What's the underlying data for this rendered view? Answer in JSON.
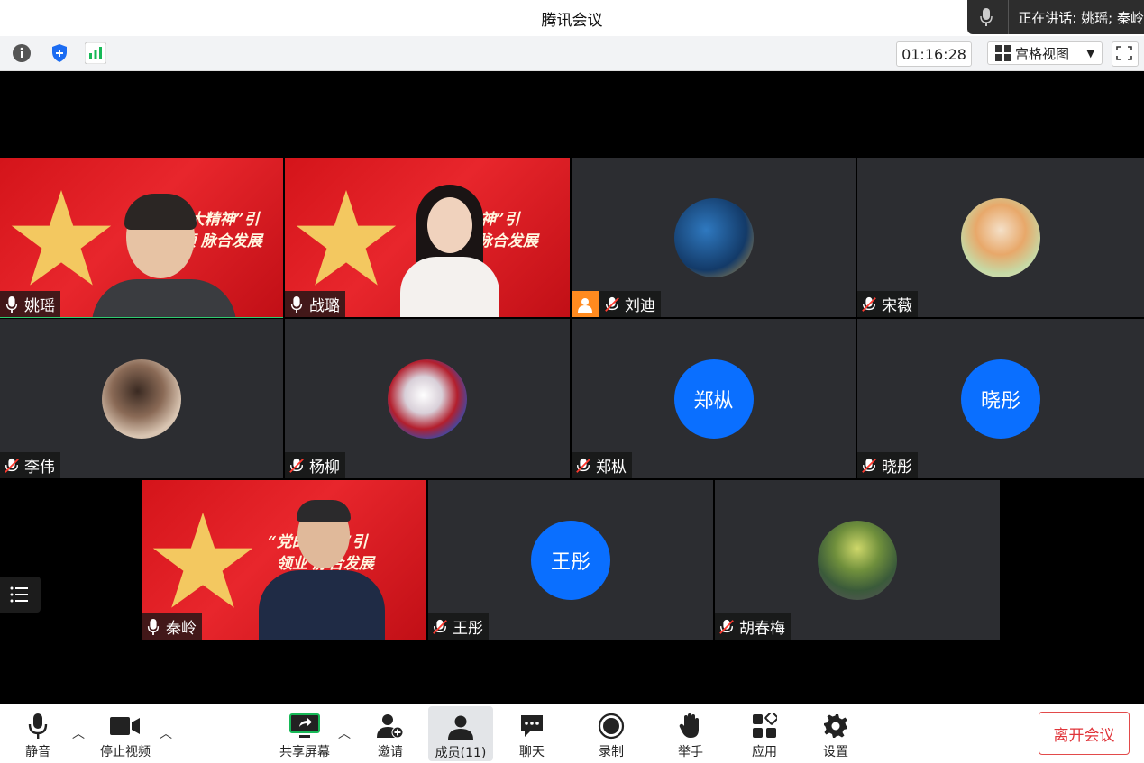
{
  "window": {
    "title": "腾讯会议"
  },
  "speaking": {
    "label": "正在讲话: 姚瑶; 秦岭"
  },
  "header": {
    "timer": "01:16:28",
    "view_label": "宫格视图"
  },
  "tiles": {
    "t1": {
      "name": "姚瑶",
      "mic": "on",
      "banner1": "“大精神”引",
      "banner2": "领      脉合发展"
    },
    "t2": {
      "name": "战璐",
      "mic": "on",
      "banner1": "“党    大精神”引",
      "banner2": "领      脉合发展"
    },
    "t3": {
      "name": "刘迪",
      "mic": "muted"
    },
    "t4": {
      "name": "宋薇",
      "mic": "muted"
    },
    "t5": {
      "name": "李伟",
      "mic": "muted"
    },
    "t6": {
      "name": "杨柳",
      "mic": "muted"
    },
    "t7": {
      "name": "郑枞",
      "mic": "muted",
      "avatar_text": "郑枞"
    },
    "t8": {
      "name": "晓彤",
      "mic": "muted",
      "avatar_text": "晓彤"
    },
    "t9": {
      "name": "秦岭",
      "mic": "on",
      "banner1": "“党的    精神”引",
      "banner2": "领业       脉合发展"
    },
    "t10": {
      "name": "王彤",
      "mic": "muted",
      "avatar_text": "王彤"
    },
    "t11": {
      "name": "胡春梅",
      "mic": "muted"
    }
  },
  "bottom": {
    "mute": "静音",
    "stop_video": "停止视频",
    "share": "共享屏幕",
    "invite": "邀请",
    "members": "成员(11)",
    "chat": "聊天",
    "record": "录制",
    "raise_hand": "举手",
    "apps": "应用",
    "settings": "设置",
    "leave": "离开会议"
  },
  "colors": {
    "avatar_blue": "#0a6fff",
    "leave_red": "#e0353a",
    "banner_red": "#d4141a"
  }
}
